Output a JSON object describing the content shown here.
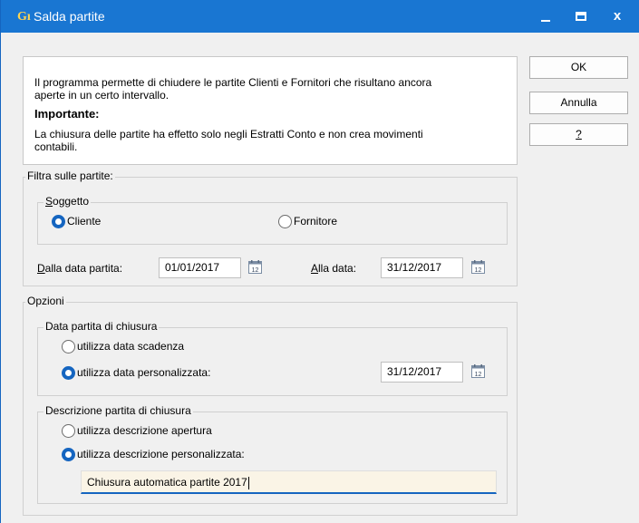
{
  "window": {
    "title": "Salda partite",
    "icon_glyph": "G",
    "icon_mark": "ı",
    "minimize_glyph": "",
    "maximize_glyph": "",
    "close_glyph": "x"
  },
  "info": {
    "line1": "Il programma permette di chiudere le partite Clienti e Fornitori che risultano ancora",
    "line2": "aperte in un certo intervallo.",
    "heading": "Importante:",
    "line3": "La chiusura delle partite ha effetto solo negli Estratti Conto e non crea movimenti",
    "line4": "contabili."
  },
  "buttons": {
    "ok": "OK",
    "annulla": "Annulla",
    "help": "?"
  },
  "filter": {
    "group_label": "Filtra sulle partite:",
    "soggetto_label": "Soggetto",
    "cliente_label": "Cliente",
    "fornitore_label": "Fornitore",
    "selected": "Cliente",
    "dalla_data_label": "Dalla data partita:",
    "dalla_data_value": "01/01/2017",
    "alla_data_label": "Alla data:",
    "alla_data_value": "31/12/2017"
  },
  "options": {
    "group_label": "Opzioni",
    "data_group_label": "Data partita di chiusura",
    "data_scadenza_label": "utilizza data scadenza",
    "data_personalizzata_label": "utilizza data personalizzata:",
    "data_selected": "utilizza data personalizzata:",
    "data_personalizzata_value": "31/12/2017",
    "desc_group_label": "Descrizione partita di chiusura",
    "desc_apertura_label": "utilizza descrizione apertura",
    "desc_personalizzata_label": "utilizza descrizione personalizzata:",
    "desc_selected": "utilizza descrizione personalizzata:",
    "desc_personalizzata_value": "Chiusura automatica partite 2017"
  },
  "colors": {
    "titlebar": "#1976d2",
    "accent": "#1565c0",
    "window_bg": "#f0f0f0",
    "input_highlight": "#faf4e6"
  },
  "icons": {
    "app": "app-logo-icon",
    "calendar": "calendar-icon"
  }
}
